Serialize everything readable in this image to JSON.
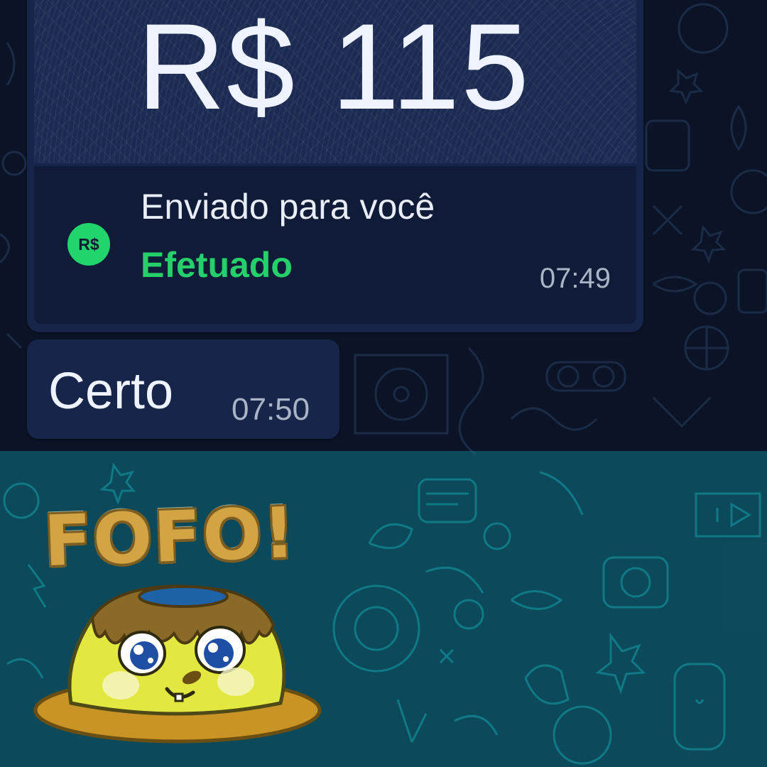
{
  "chat": {
    "payment": {
      "amount": "R$ 115",
      "badge": "R$",
      "description": "Enviado para você",
      "status": "Efetuado",
      "time": "07:49"
    },
    "message": {
      "text": "Certo",
      "time": "07:50"
    },
    "sticker": {
      "caption": "FOFO!",
      "icon": "pudding-sticker"
    }
  },
  "colors": {
    "background": "#0b1326",
    "bubble": "#17254a",
    "status_green": "#25d06a",
    "selection_teal": "#0f7887",
    "sticker_gold": "#d3a443"
  }
}
